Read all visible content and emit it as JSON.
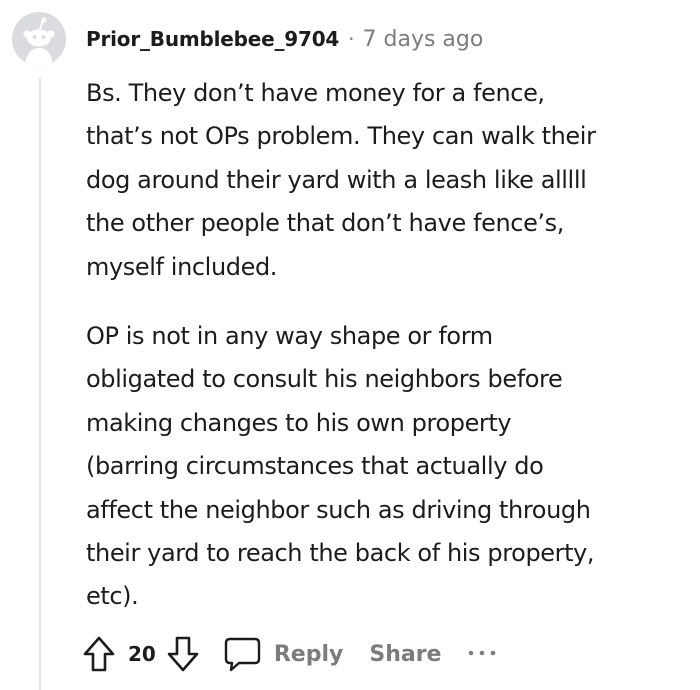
{
  "comment": {
    "author": "Prior_Bumblebee_9704",
    "separator": "·",
    "time_ago": "7 days ago",
    "paragraphs": [
      "Bs. They don’t have money for a fence,\nthat’s not OPs problem. They can walk their\ndog around their yard with a leash like alllll\nthe other people that don’t have fence’s,\nmyself included.",
      "OP is not in any way shape or form\nobligated to consult his neighbors before\nmaking changes to his own property\n(barring circumstances that actually do\naffect the neighbor such as driving through\ntheir yard to reach the back of his property,\netc)."
    ]
  },
  "actions": {
    "vote_count": "20",
    "reply_label": "Reply",
    "share_label": "Share",
    "more_icon": "ellipsis-icon",
    "upvote_icon": "upvote-arrow-icon",
    "downvote_icon": "downvote-arrow-icon",
    "reply_icon": "speech-bubble-icon"
  },
  "colors": {
    "avatar_bg": "#d7dadc",
    "text": "#1c1c1c",
    "muted": "#7c7c7c",
    "thread_line": "#e6e6e6"
  }
}
